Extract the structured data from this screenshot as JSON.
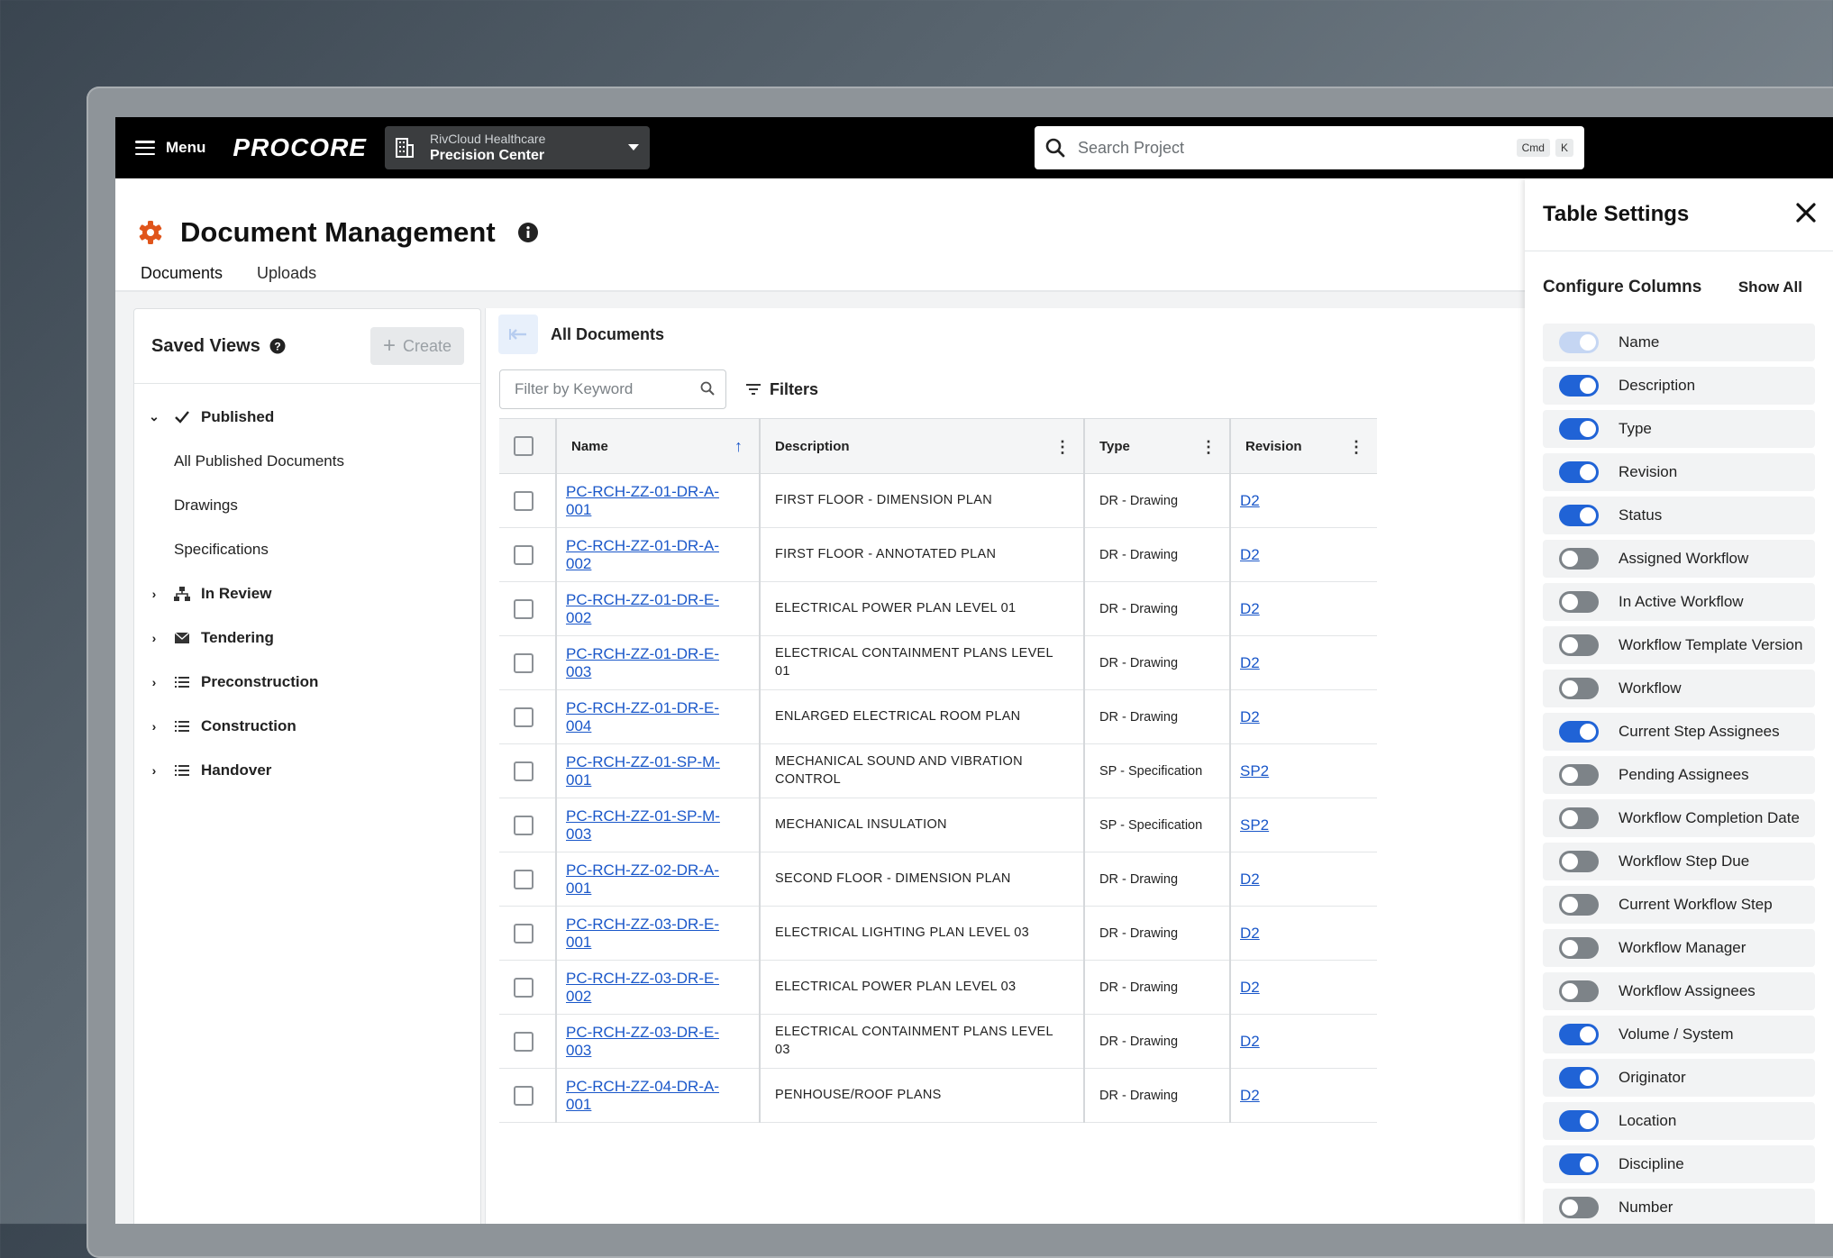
{
  "nav": {
    "menu_label": "Menu",
    "logo_text": "PROCORE",
    "project_company": "RivCloud Healthcare",
    "project_name": "Precision Center",
    "search_placeholder": "Search Project",
    "shortcut_keys": [
      "Cmd",
      "K"
    ]
  },
  "header": {
    "title": "Document Management",
    "tabs": [
      {
        "label": "Documents",
        "active": true
      },
      {
        "label": "Uploads",
        "active": false
      }
    ]
  },
  "saved_views": {
    "title": "Saved Views",
    "create_label": "Create",
    "items": [
      {
        "label": "Published",
        "level": "parent",
        "icon": "checkmark-icon",
        "chevron": "down"
      },
      {
        "label": "All Published Documents",
        "level": "child"
      },
      {
        "label": "Drawings",
        "level": "child"
      },
      {
        "label": "Specifications",
        "level": "child"
      },
      {
        "label": "In Review",
        "level": "parent",
        "icon": "hierarchy-icon",
        "chevron": "right"
      },
      {
        "label": "Tendering",
        "level": "parent",
        "icon": "envelope-icon",
        "chevron": "right"
      },
      {
        "label": "Preconstruction",
        "level": "parent",
        "icon": "list-icon",
        "chevron": "right"
      },
      {
        "label": "Construction",
        "level": "parent",
        "icon": "list-icon",
        "chevron": "right"
      },
      {
        "label": "Handover",
        "level": "parent",
        "icon": "list-icon",
        "chevron": "right"
      }
    ]
  },
  "table": {
    "view_title": "All Documents",
    "filter_placeholder": "Filter by Keyword",
    "filters_label": "Filters",
    "columns": [
      "Name",
      "Description",
      "Type",
      "Revision"
    ],
    "rows": [
      {
        "name": "PC-RCH-ZZ-01-DR-A-001",
        "description": "FIRST FLOOR - DIMENSION PLAN",
        "type": "DR - Drawing",
        "revision": "D2"
      },
      {
        "name": "PC-RCH-ZZ-01-DR-A-002",
        "description": "FIRST FLOOR - ANNOTATED PLAN",
        "type": "DR - Drawing",
        "revision": "D2"
      },
      {
        "name": "PC-RCH-ZZ-01-DR-E-002",
        "description": "ELECTRICAL POWER PLAN LEVEL 01",
        "type": "DR - Drawing",
        "revision": "D2"
      },
      {
        "name": "PC-RCH-ZZ-01-DR-E-003",
        "description": "ELECTRICAL CONTAINMENT PLANS LEVEL 01",
        "type": "DR - Drawing",
        "revision": "D2"
      },
      {
        "name": "PC-RCH-ZZ-01-DR-E-004",
        "description": "ENLARGED ELECTRICAL ROOM PLAN",
        "type": "DR - Drawing",
        "revision": "D2"
      },
      {
        "name": "PC-RCH-ZZ-01-SP-M-001",
        "description": "MECHANICAL SOUND AND VIBRATION CONTROL",
        "type": "SP - Specification",
        "revision": "SP2"
      },
      {
        "name": "PC-RCH-ZZ-01-SP-M-003",
        "description": "MECHANICAL INSULATION",
        "type": "SP - Specification",
        "revision": "SP2"
      },
      {
        "name": "PC-RCH-ZZ-02-DR-A-001",
        "description": "SECOND FLOOR - DIMENSION PLAN",
        "type": "DR - Drawing",
        "revision": "D2"
      },
      {
        "name": "PC-RCH-ZZ-03-DR-E-001",
        "description": "ELECTRICAL LIGHTING PLAN LEVEL 03",
        "type": "DR - Drawing",
        "revision": "D2"
      },
      {
        "name": "PC-RCH-ZZ-03-DR-E-002",
        "description": "ELECTRICAL POWER PLAN LEVEL 03",
        "type": "DR - Drawing",
        "revision": "D2"
      },
      {
        "name": "PC-RCH-ZZ-03-DR-E-003",
        "description": "ELECTRICAL CONTAINMENT PLANS LEVEL 03",
        "type": "DR - Drawing",
        "revision": "D2"
      },
      {
        "name": "PC-RCH-ZZ-04-DR-A-001",
        "description": "PENHOUSE/ROOF PLANS",
        "type": "DR - Drawing",
        "revision": "D2"
      }
    ]
  },
  "settings": {
    "title": "Table Settings",
    "section_title": "Configure Columns",
    "show_all_label": "Show All",
    "columns": [
      {
        "label": "Name",
        "state": "locked"
      },
      {
        "label": "Description",
        "state": "on"
      },
      {
        "label": "Type",
        "state": "on"
      },
      {
        "label": "Revision",
        "state": "on"
      },
      {
        "label": "Status",
        "state": "on"
      },
      {
        "label": "Assigned Workflow",
        "state": "off"
      },
      {
        "label": "In Active Workflow",
        "state": "off"
      },
      {
        "label": "Workflow Template Version",
        "state": "off"
      },
      {
        "label": "Workflow",
        "state": "off"
      },
      {
        "label": "Current Step Assignees",
        "state": "on"
      },
      {
        "label": "Pending Assignees",
        "state": "off"
      },
      {
        "label": "Workflow Completion Date",
        "state": "off"
      },
      {
        "label": "Workflow Step Due",
        "state": "off"
      },
      {
        "label": "Current Workflow Step",
        "state": "off"
      },
      {
        "label": "Workflow Manager",
        "state": "off"
      },
      {
        "label": "Workflow Assignees",
        "state": "off"
      },
      {
        "label": "Volume / System",
        "state": "on"
      },
      {
        "label": "Originator",
        "state": "on"
      },
      {
        "label": "Location",
        "state": "on"
      },
      {
        "label": "Discipline",
        "state": "on"
      },
      {
        "label": "Number",
        "state": "off"
      }
    ]
  },
  "colors": {
    "accent_blue": "#2063d6",
    "link_blue": "#1a57c9",
    "brand_orange": "#e0551b",
    "nav_black": "#000000"
  }
}
